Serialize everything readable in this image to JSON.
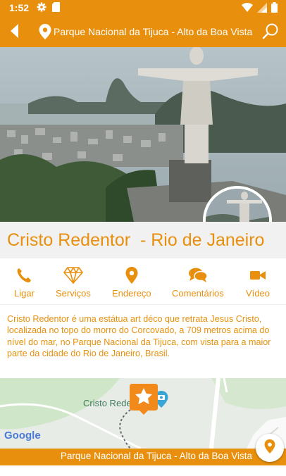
{
  "status_bar": {
    "time": "1:52",
    "icons": [
      "gear-icon",
      "sd-card-icon",
      "wifi-icon",
      "signal-icon",
      "battery-icon"
    ]
  },
  "app_bar": {
    "title": "Parque Nacional da Tijuca - Alto da Boa Vista",
    "back_icon": "back-arrow-icon",
    "location_icon": "map-pin-icon",
    "search_icon": "search-icon"
  },
  "place": {
    "title": "Cristo Redentor  - Rio de Janeiro",
    "description": "Cristo Redentor é uma estátua art déco que retrata Jesus Cristo, localizada no topo do morro do Corcovado, a 709 metros acima do nível do mar, no Parque Nacional da Tijuca, com vista para a maior parte da cidade do Rio de Janeiro, Brasil."
  },
  "actions": [
    {
      "label": "Ligar",
      "icon": "phone-icon"
    },
    {
      "label": "Serviços",
      "icon": "diamond-icon"
    },
    {
      "label": "Endereço",
      "icon": "map-pin-icon"
    },
    {
      "label": "Comentários",
      "icon": "chat-icon"
    },
    {
      "label": "Vídeo",
      "icon": "video-camera-icon"
    }
  ],
  "map": {
    "place_label": "Cristo Rede",
    "logo": "Google",
    "marker_icon": "star-marker-icon"
  },
  "footer": {
    "text": "Parque Nacional da Tijuca - Alto da Boa Vista",
    "fab_icon": "map-pin-icon"
  },
  "colors": {
    "accent": "#e8900e",
    "title_band": "#f1f1f1",
    "map_bg": "#e8ece6"
  }
}
